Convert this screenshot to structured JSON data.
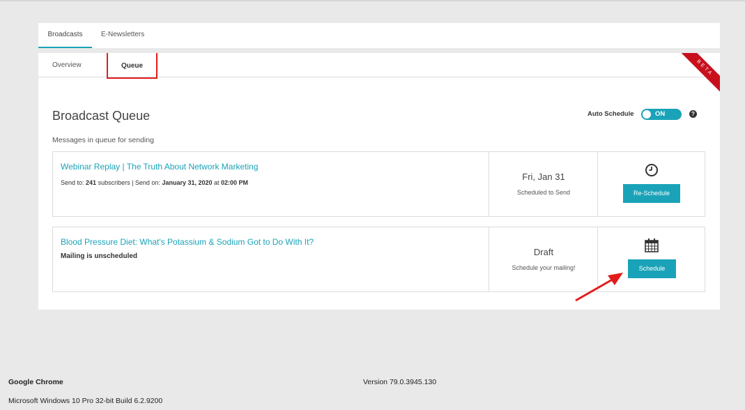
{
  "top_tabs": [
    {
      "label": "Broadcasts"
    },
    {
      "label": "E-Newsletters"
    }
  ],
  "sub_tabs": [
    {
      "label": "Overview"
    },
    {
      "label": "Queue"
    }
  ],
  "beta_label": "BETA",
  "page_title": "Broadcast Queue",
  "subtitle": "Messages in queue for sending",
  "auto_schedule": {
    "label": "Auto Schedule",
    "state": "ON"
  },
  "help": "?",
  "cards": [
    {
      "title": "Webinar Replay | The Truth About Network Marketing",
      "send_to_prefix": "Send to: ",
      "subscriber_count": "241",
      "send_on_prefix": " subscribers | Send on: ",
      "send_date": "January 31, 2020",
      "at": " at ",
      "send_time": "02:00 PM",
      "date_big": "Fri, Jan 31",
      "date_small": "Scheduled to Send",
      "action_icon": "clock-icon",
      "action_label": "Re-Schedule"
    },
    {
      "title": "Blood Pressure Diet: What's Potassium & Sodium Got to Do With It?",
      "status": "Mailing is unscheduled",
      "date_big": "Draft",
      "date_small": "Schedule your mailing!",
      "action_icon": "calendar-icon",
      "action_label": "Schedule"
    }
  ],
  "footer": {
    "browser": "Google Chrome",
    "version": "Version 79.0.3945.130",
    "os": "Microsoft Windows 10 Pro 32-bit Build 6.2.9200"
  },
  "colors": {
    "accent": "#1aa3b8",
    "highlight": "#e21c1c",
    "beta": "#c8101d"
  }
}
